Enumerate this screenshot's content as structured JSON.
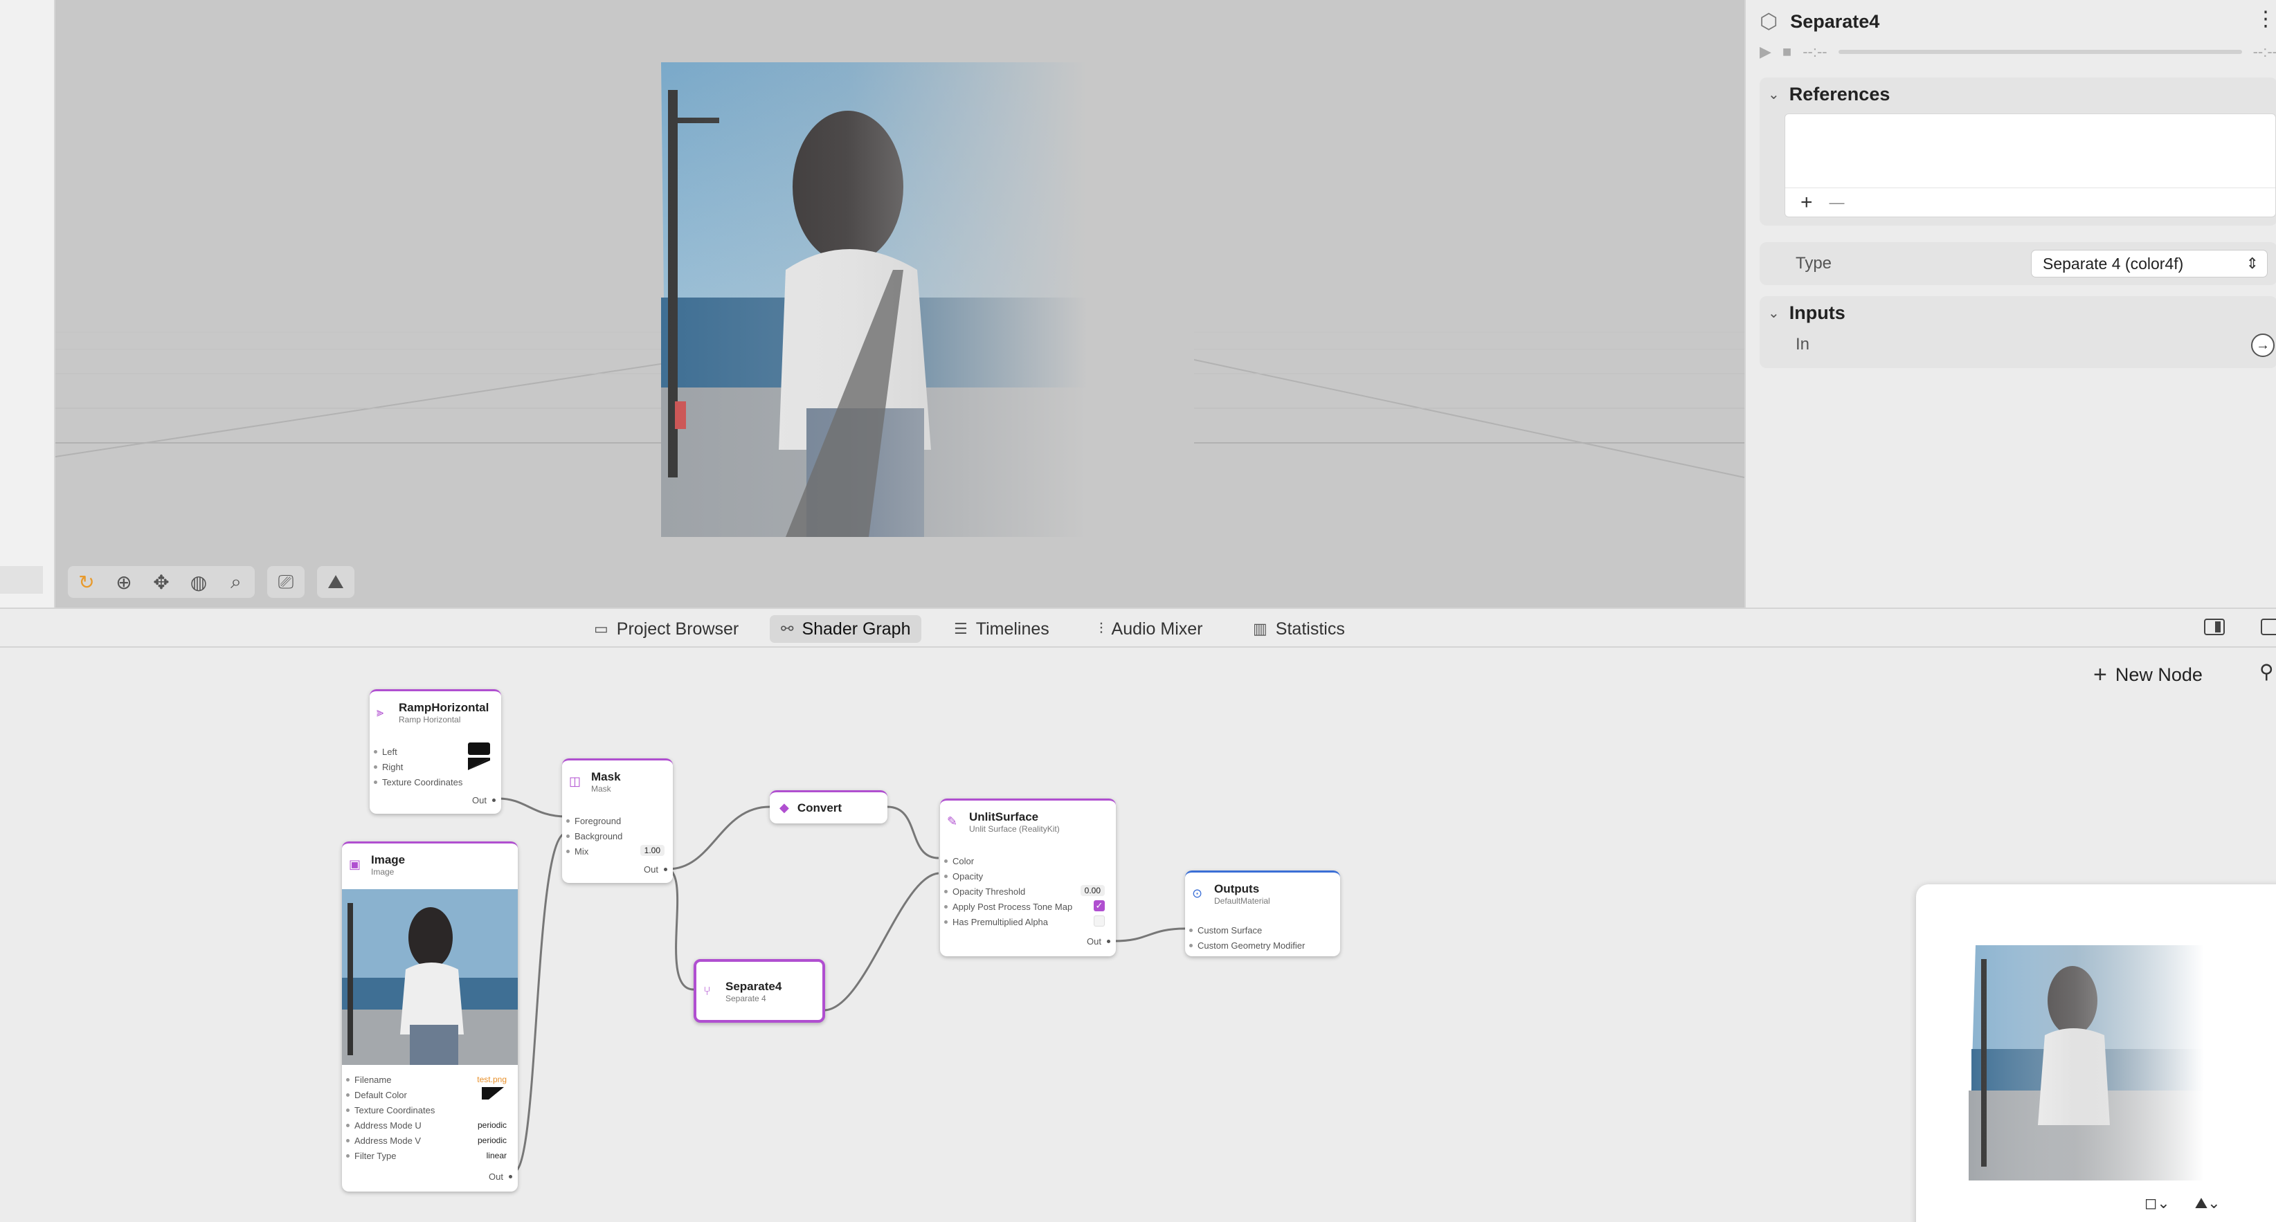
{
  "inspector": {
    "title": "Separate4",
    "time_start": "--:--",
    "time_end": "--:--",
    "references_label": "References",
    "add_label": "+",
    "remove_label": "—",
    "type_label": "Type",
    "type_value": "Separate 4 (color4f)",
    "inputs_label": "Inputs",
    "in_label": "In"
  },
  "tabs": [
    {
      "label": "Project Browser",
      "icon": "folder-icon"
    },
    {
      "label": "Shader Graph",
      "icon": "node-graph-icon",
      "active": true
    },
    {
      "label": "Timelines",
      "icon": "timeline-icon"
    },
    {
      "label": "Audio Mixer",
      "icon": "mixer-icon"
    },
    {
      "label": "Statistics",
      "icon": "bar-chart-icon"
    }
  ],
  "graph": {
    "new_node_label": "New Node",
    "nodes": {
      "ramp": {
        "title": "RampHorizontal",
        "subtitle": "Ramp Horizontal",
        "left": "Left",
        "right": "Right",
        "texcoord": "Texture Coordinates",
        "out": "Out"
      },
      "image": {
        "title": "Image",
        "subtitle": "Image",
        "filename_label": "Filename",
        "filename_value": "test.png",
        "default_color": "Default Color",
        "texcoord": "Texture Coordinates",
        "address_u": "Address Mode U",
        "address_u_value": "periodic",
        "address_v": "Address Mode V",
        "address_v_value": "periodic",
        "filter": "Filter Type",
        "filter_value": "linear",
        "out": "Out"
      },
      "mask": {
        "title": "Mask",
        "subtitle": "Mask",
        "foreground": "Foreground",
        "background": "Background",
        "mix": "Mix",
        "mix_value": "1.00",
        "out": "Out"
      },
      "convert": {
        "title": "Convert"
      },
      "separate": {
        "title": "Separate4",
        "subtitle": "Separate 4"
      },
      "unlit": {
        "title": "UnlitSurface",
        "subtitle": "Unlit Surface (RealityKit)",
        "color": "Color",
        "opacity": "Opacity",
        "opacity_threshold": "Opacity Threshold",
        "opacity_threshold_value": "0.00",
        "apply_tone_map": "Apply Post Process Tone Map",
        "premultiplied": "Has Premultiplied Alpha",
        "out": "Out"
      },
      "outputs": {
        "title": "Outputs",
        "subtitle": "DefaultMaterial",
        "custom_surface": "Custom Surface",
        "custom_geometry": "Custom Geometry Modifier"
      }
    }
  },
  "colors": {
    "accent": "#b04fd0",
    "orange": "#e8912c"
  }
}
